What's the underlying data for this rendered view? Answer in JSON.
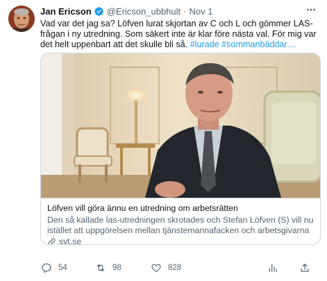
{
  "tweet": {
    "author_name": "Jan Ericson",
    "handle": "@Ericson_ubbhult",
    "separator": "·",
    "date": "Nov 1",
    "text_plain": "Vad var det jag sa? Löfven lurat skjortan av C och L och gömmer LAS-frågan i ny utredning. Som säkert inte är klar före nästa val. För mig var det helt uppenbart att det skulle bli så.",
    "hashtag_1": "#lurade",
    "hashtag_2": "#sommanbäddar",
    "ellipsis": "…"
  },
  "card": {
    "title": "Löfven vill göra ännu en utredning om arbetsrätten",
    "description": "Den så kallade las-utredningen skrotades och Stefan Löfven (S) vill nu istället att uppgörelsen mellan tjänstemannafacken och arbetsgivarna s...",
    "domain": "svt.se"
  },
  "actions": {
    "reply_count": "54",
    "retweet_count": "98",
    "like_count": "828"
  },
  "colors": {
    "accent": "#1d9bf0",
    "secondary_text": "#536471",
    "border": "#cfd9de"
  },
  "icons": [
    "verified-badge-icon",
    "more-icon",
    "link-icon",
    "reply-icon",
    "retweet-icon",
    "like-icon",
    "analytics-icon",
    "share-icon"
  ]
}
